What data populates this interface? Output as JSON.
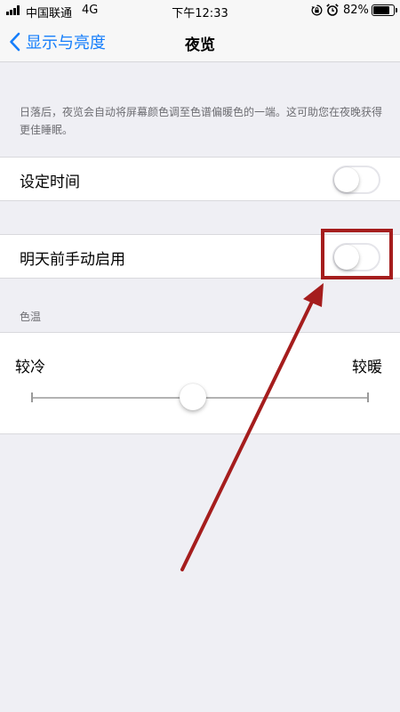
{
  "status_bar": {
    "carrier": "中国联通",
    "network": "4G",
    "time": "下午12:33",
    "battery_percent_label": "82%",
    "battery_level": 0.82,
    "icons": [
      "signal-icon",
      "orientation-lock-icon",
      "alarm-icon",
      "battery-icon"
    ]
  },
  "nav": {
    "back_label": "显示与亮度",
    "title": "夜览"
  },
  "description": "日落后，夜览会自动将屏幕颜色调至色谱偏暖色的一端。这可助您在夜晚获得更佳睡眠。",
  "settings": {
    "scheduled": {
      "label": "设定时间",
      "on": false
    },
    "manual": {
      "label": "明天前手动启用",
      "on": false
    }
  },
  "color_temperature": {
    "section_label": "色温",
    "less_warm_label": "较冷",
    "more_warm_label": "较暖",
    "level": 0.48
  },
  "annotation": {
    "color": "#a51d1d"
  },
  "colors": {
    "accent": "#157efb",
    "background": "#efeff4"
  }
}
